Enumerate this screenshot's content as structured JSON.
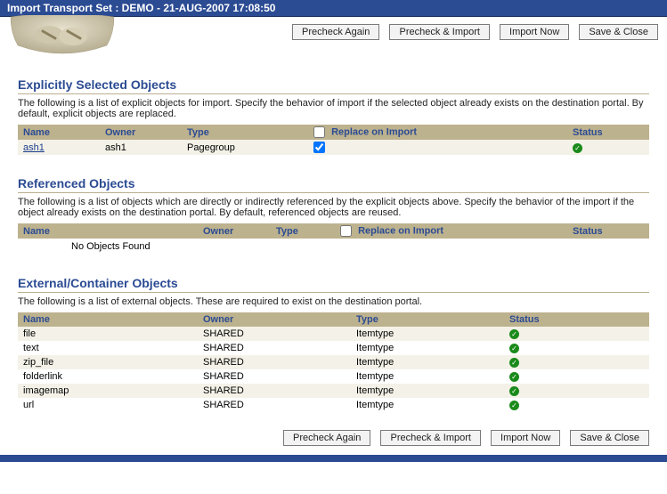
{
  "titlebar": "Import Transport Set : DEMO - 21-AUG-2007 17:08:50",
  "buttons": {
    "precheck_again": "Precheck Again",
    "precheck_import": "Precheck & Import",
    "import_now": "Import Now",
    "save_close": "Save & Close"
  },
  "explicit": {
    "heading": "Explicitly Selected Objects",
    "desc": "The following is a list of explicit objects for import. Specify the behavior of import if the selected object already exists on the destination portal. By default, explicit objects are replaced.",
    "cols": {
      "name": "Name",
      "owner": "Owner",
      "type": "Type",
      "replace": "Replace on Import",
      "status": "Status"
    },
    "rows": [
      {
        "name": "ash1",
        "owner": "ash1",
        "type": "Pagegroup",
        "replace_checked": true,
        "status": "ok"
      }
    ]
  },
  "referenced": {
    "heading": "Referenced Objects",
    "desc": "The following is a list of objects which are directly or indirectly referenced by the explicit objects above. Specify the behavior of the import if the object already exists on the destination portal. By default, referenced objects are reused.",
    "cols": {
      "name": "Name",
      "owner": "Owner",
      "type": "Type",
      "replace": "Replace on Import",
      "status": "Status"
    },
    "empty": "No Objects Found"
  },
  "external": {
    "heading": "External/Container Objects",
    "desc": "The following is a list of external objects. These are required to exist on the destination portal.",
    "cols": {
      "name": "Name",
      "owner": "Owner",
      "type": "Type",
      "status": "Status"
    },
    "rows": [
      {
        "name": "file",
        "owner": "SHARED",
        "type": "Itemtype",
        "status": "ok"
      },
      {
        "name": "text",
        "owner": "SHARED",
        "type": "Itemtype",
        "status": "ok"
      },
      {
        "name": "zip_file",
        "owner": "SHARED",
        "type": "Itemtype",
        "status": "ok"
      },
      {
        "name": "folderlink",
        "owner": "SHARED",
        "type": "Itemtype",
        "status": "ok"
      },
      {
        "name": "imagemap",
        "owner": "SHARED",
        "type": "Itemtype",
        "status": "ok"
      },
      {
        "name": "url",
        "owner": "SHARED",
        "type": "Itemtype",
        "status": "ok"
      }
    ]
  }
}
